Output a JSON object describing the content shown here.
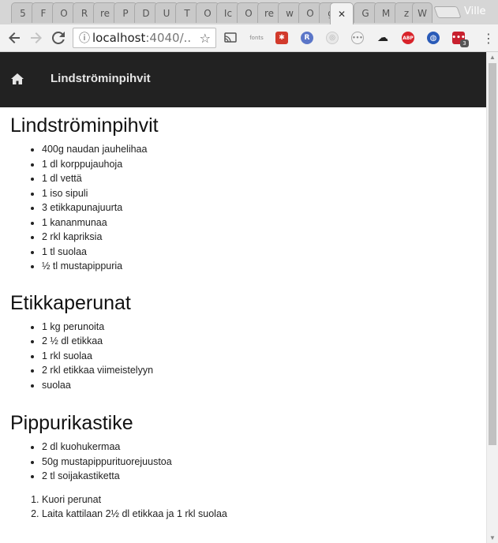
{
  "browser": {
    "tabs": [
      "5",
      "F",
      "O",
      "R",
      "re",
      "P",
      "D",
      "U",
      "T",
      "O",
      "Ic",
      "O",
      "re",
      "w",
      "O",
      "g",
      "",
      "G",
      "M",
      "z",
      "W"
    ],
    "active_tab_index": 16,
    "active_tab_close": "✕",
    "profile_name": "Ville",
    "url_host": "localhost",
    "url_rest": ":4040/...",
    "extensions": [
      {
        "name": "cast",
        "label": ""
      },
      {
        "name": "fonts",
        "label": "fonts"
      },
      {
        "name": "ext-red",
        "label": ""
      },
      {
        "name": "ext-r",
        "label": "R"
      },
      {
        "name": "ext-gray",
        "label": ""
      },
      {
        "name": "ext-dots",
        "label": ""
      },
      {
        "name": "ext-paw",
        "label": ""
      },
      {
        "name": "adblock",
        "label": "ABP"
      },
      {
        "name": "ext-globe",
        "label": ""
      },
      {
        "name": "ext-badge",
        "label": "3"
      }
    ]
  },
  "colors": {
    "navbar_bg": "#222222",
    "brand_text": "#e6e6e6"
  },
  "navbar": {
    "home_icon": "home-icon",
    "brand": "Lindströminpihvit"
  },
  "sections": [
    {
      "title": "Lindströminpihvit",
      "items": [
        "400g naudan jauhelihaa",
        "1 dl korppujauhoja",
        "1 dl vettä",
        "1 iso sipuli",
        "3 etikkapunajuurta",
        "1 kananmunaa",
        "2 rkl kapriksia",
        "1 tl suolaa",
        "½ tl mustapippuria"
      ]
    },
    {
      "title": "Etikkaperunat",
      "items": [
        "1 kg perunoita",
        "2 ½ dl etikkaa",
        "1 rkl suolaa",
        "2 rkl etikkaa viimeistelyyn",
        "suolaa"
      ]
    },
    {
      "title": "Pippurikastike",
      "items": [
        "2 dl kuohukermaa",
        "50g mustapippurituorejuustoa",
        "2 tl soijakastiketta"
      ]
    }
  ],
  "steps": [
    "Kuori perunat",
    "Laita kattilaan 2½ dl etikkaa ja 1 rkl suolaa"
  ]
}
